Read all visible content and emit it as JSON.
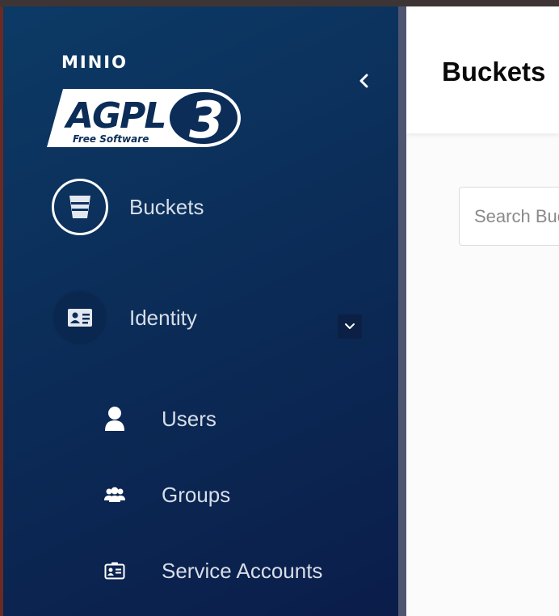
{
  "sidebar": {
    "brand": "MINIO",
    "logo": {
      "main_text": "AGPL",
      "version_text": "3",
      "sub_text": "Free Software"
    },
    "collapse_icon": "chevron-left-icon",
    "items": [
      {
        "label": "Buckets",
        "icon": "bucket-icon",
        "active": true
      },
      {
        "label": "Identity",
        "icon": "id-card-icon",
        "active": false,
        "expanded": true,
        "children": [
          {
            "label": "Users",
            "icon": "user-icon"
          },
          {
            "label": "Groups",
            "icon": "groups-icon"
          },
          {
            "label": "Service Accounts",
            "icon": "service-account-icon"
          }
        ]
      }
    ]
  },
  "main": {
    "title": "Buckets",
    "search": {
      "placeholder": "Search Buckets",
      "value": ""
    }
  },
  "colors": {
    "sidebar_top": "#0c3a66",
    "sidebar_bottom": "#0b1d4a",
    "main_bg": "#fbfbfb"
  }
}
